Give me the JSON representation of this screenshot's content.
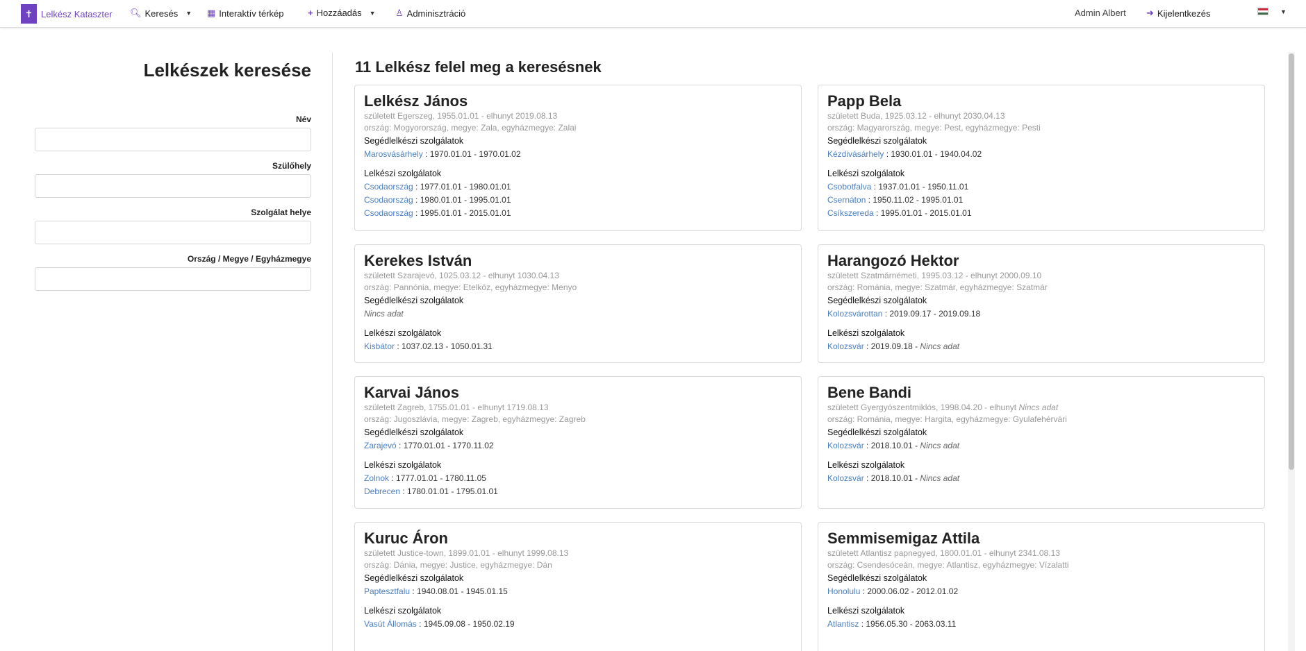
{
  "nav": {
    "brand": "Lelkész Kataszter",
    "search": "Keresés",
    "map": "Interaktív térkép",
    "add": "Hozzáadás",
    "admin": "Adminisztráció",
    "user": "Admin Albert",
    "logout": "Kijelentkezés"
  },
  "sidebar": {
    "title": "Lelkészek keresése",
    "name_label": "Név",
    "birthplace_label": "Szülőhely",
    "service_label": "Szolgálat helye",
    "region_label": "Ország / Megye / Egyházmegye"
  },
  "results": {
    "title": "11 Lelkész felel meg a keresésnek",
    "assistant_title": "Segédlelkészi szolgálatok",
    "pastor_title": "Lelkészi szolgálatok",
    "no_data": "Nincs adat",
    "cards": [
      {
        "name": "Lelkész János",
        "born": "született Egerszeg, 1955.01.01 - elhunyt 2019.08.13",
        "region": "ország: Mogyorország, megye: Zala, egyházmegye: Zalai",
        "assistant": [
          {
            "place": "Marosvásárhely",
            "dates": " : 1970.01.01 - 1970.01.02"
          }
        ],
        "pastor": [
          {
            "place": "Csodaország",
            "dates": " : 1977.01.01 - 1980.01.01"
          },
          {
            "place": "Csodaország",
            "dates": " : 1980.01.01 - 1995.01.01"
          },
          {
            "place": "Csodaország",
            "dates": " : 1995.01.01 - 2015.01.01"
          }
        ]
      },
      {
        "name": "Papp Bela",
        "born": "született Buda, 1925.03.12 - elhunyt 2030.04.13",
        "region": "ország: Magyarország, megye: Pest, egyházmegye: Pesti",
        "assistant": [
          {
            "place": "Kézdivásárhely",
            "dates": " : 1930.01.01 - 1940.04.02"
          }
        ],
        "pastor": [
          {
            "place": "Csobotfalva",
            "dates": " : 1937.01.01 - 1950.11.01"
          },
          {
            "place": "Csernáton",
            "dates": " : 1950.11.02 - 1995.01.01"
          },
          {
            "place": "Csíkszereda",
            "dates": " : 1995.01.01 - 2015.01.01"
          }
        ]
      },
      {
        "name": "Kerekes István",
        "born": "született Szarajevó, 1025.03.12 - elhunyt 1030.04.13",
        "region": "ország: Pannónia, megye: Etelköz, egyházmegye: Menyo",
        "assistant_na": "Nincs adat",
        "pastor": [
          {
            "place": "Kisbátor",
            "dates": " : 1037.02.13 - 1050.01.31"
          }
        ]
      },
      {
        "name": "Harangozó Hektor",
        "born": "született Szatmárnémeti, 1995.03.12 - elhunyt 2000.09.10",
        "region": "ország: Románia, megye: Szatmár, egyházmegye: Szatmár",
        "assistant": [
          {
            "place": "Kolozsvárottan",
            "dates": " : 2019.09.17 - 2019.09.18"
          }
        ],
        "pastor": [
          {
            "place": "Kolozsvár",
            "dates": " : 2019.09.18 - ",
            "na": "Nincs adat"
          }
        ]
      },
      {
        "name": "Karvai János",
        "born": "született Zagreb, 1755.01.01 - elhunyt 1719.08.13",
        "region": "ország: Jugoszlávia, megye: Zagreb, egyházmegye: Zagreb",
        "assistant": [
          {
            "place": "Zarajevó",
            "dates": " : 1770.01.01 - 1770.11.02"
          }
        ],
        "pastor": [
          {
            "place": "Zolnok",
            "dates": " : 1777.01.01 - 1780.11.05"
          },
          {
            "place": "Debrecen",
            "dates": " : 1780.01.01 - 1795.01.01"
          }
        ]
      },
      {
        "name": "Bene Bandi",
        "born": "született Gyergyószentmiklós, 1998.04.20 - elhunyt ",
        "born_na": "Nincs adat",
        "region": "ország: Románia, megye: Hargita, egyházmegye: Gyulafehérvári",
        "assistant": [
          {
            "place": "Kolozsvár",
            "dates": " : 2018.10.01 - ",
            "na": "Nincs adat"
          }
        ],
        "pastor": [
          {
            "place": "Kolozsvár",
            "dates": " : 2018.10.01 - ",
            "na": "Nincs adat"
          }
        ]
      },
      {
        "name": "Kuruc Áron",
        "born": "született Justice-town, 1899.01.01 - elhunyt 1999.08.13",
        "region": "ország: Dánia, megye: Justice, egyházmegye: Dán",
        "assistant": [
          {
            "place": "Paptesztfalu",
            "dates": " : 1940.08.01 - 1945.01.15"
          }
        ],
        "pastor": [
          {
            "place": "Vasút Állomás",
            "dates": " : 1945.09.08 - 1950.02.19"
          }
        ]
      },
      {
        "name": "Semmisemigaz Attila",
        "born": "született Atlantisz papnegyed, 1800.01.01 - elhunyt 2341.08.13",
        "region": "ország: Csendesóceán, megye: Atlantisz, egyházmegye: Vízalatti",
        "assistant": [
          {
            "place": "Honolulu",
            "dates": " : 2000.06.02 - 2012.01.02"
          }
        ],
        "pastor": [
          {
            "place": "Atlantisz",
            "dates": " : 1956.05.30 - 2063.03.11"
          }
        ]
      }
    ]
  }
}
